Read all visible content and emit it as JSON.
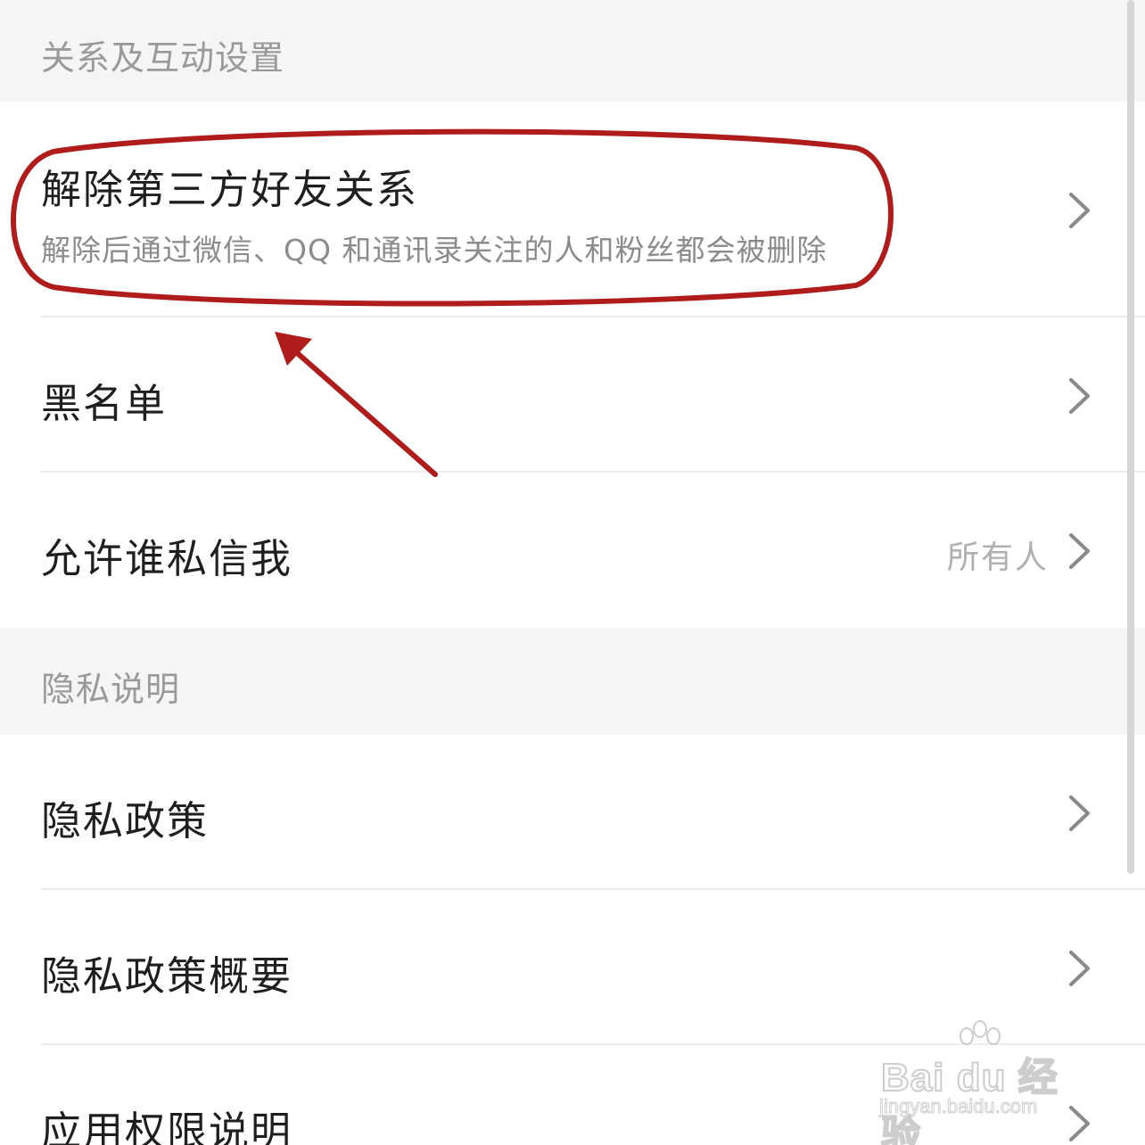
{
  "sections": [
    {
      "header": "关系及互动设置",
      "items": [
        {
          "title": "解除第三方好友关系",
          "subtitle": "解除后通过微信、QQ 和通讯录关注的人和粉丝都会被删除"
        },
        {
          "title": "黑名单"
        },
        {
          "title": "允许谁私信我",
          "value": "所有人"
        }
      ]
    },
    {
      "header": "隐私说明",
      "items": [
        {
          "title": "隐私政策"
        },
        {
          "title": "隐私政策概要"
        },
        {
          "title": "应用权限说明"
        }
      ]
    }
  ],
  "icons": {
    "row_chevron": "chevron-right-icon"
  },
  "annotation": {
    "color": "#b01c1c",
    "shapes": [
      "ellipse-highlight",
      "arrow"
    ]
  },
  "watermark": {
    "brand": "Bai du 经验",
    "url": "jingyan.baidu.com"
  },
  "colors": {
    "section_background": "#f5f5f5",
    "title_text": "#1f1f1f",
    "secondary_text": "#8c8c8c",
    "chevron": "#8a8a8a",
    "annotation": "#b01c1c"
  }
}
